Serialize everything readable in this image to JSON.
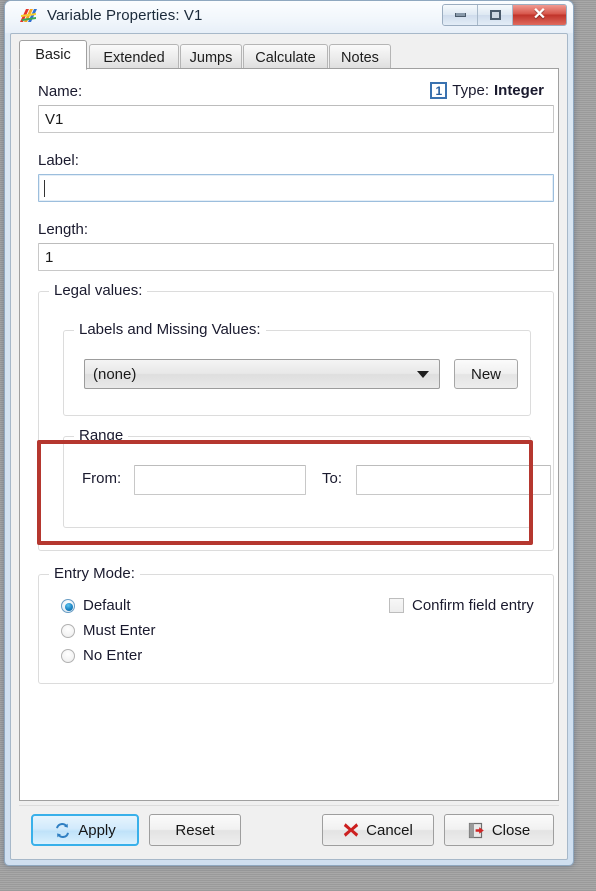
{
  "window": {
    "title": "Variable Properties: V1",
    "app_icon": "cspro-flag-icon",
    "controls": {
      "minimize": "Minimize",
      "maximize": "Maximize",
      "close": "✕"
    }
  },
  "tabs": [
    {
      "label": "Basic",
      "active": true
    },
    {
      "label": "Extended",
      "active": false
    },
    {
      "label": "Jumps",
      "active": false
    },
    {
      "label": "Calculate",
      "active": false
    },
    {
      "label": "Notes",
      "active": false
    }
  ],
  "basic": {
    "name": {
      "label": "Name:",
      "value": "V1",
      "placeholder": ""
    },
    "type": {
      "icon_text": "1",
      "prefix": "Type:",
      "value": "Integer"
    },
    "field_label": {
      "label": "Label:",
      "value": "",
      "placeholder": "",
      "focused": true
    },
    "length": {
      "label": "Length:",
      "value": "1",
      "placeholder": ""
    },
    "legal_values": {
      "title": "Legal values:",
      "labels_missing": {
        "title": "Labels and Missing Values:",
        "selected": "(none)",
        "options": [
          "(none)"
        ],
        "new_button": "New"
      },
      "range": {
        "title": "Range",
        "from_label": "From:",
        "from_value": "",
        "to_label": "To:",
        "to_value": "",
        "highlighted": true,
        "highlight_color": "#b5372f"
      }
    },
    "entry_mode": {
      "title": "Entry Mode:",
      "options": [
        {
          "label": "Default",
          "selected": true
        },
        {
          "label": "Must Enter",
          "selected": false
        },
        {
          "label": "No Enter",
          "selected": false
        }
      ],
      "confirm_field_entry": {
        "label": "Confirm field entry",
        "checked": false
      }
    }
  },
  "footer": {
    "apply": {
      "label": "Apply",
      "icon": "refresh-icon",
      "focused": true
    },
    "reset": {
      "label": "Reset",
      "icon": ""
    },
    "cancel": {
      "label": "Cancel",
      "icon": "red-x-icon"
    },
    "close": {
      "label": "Close",
      "icon": "exit-door-icon"
    }
  }
}
